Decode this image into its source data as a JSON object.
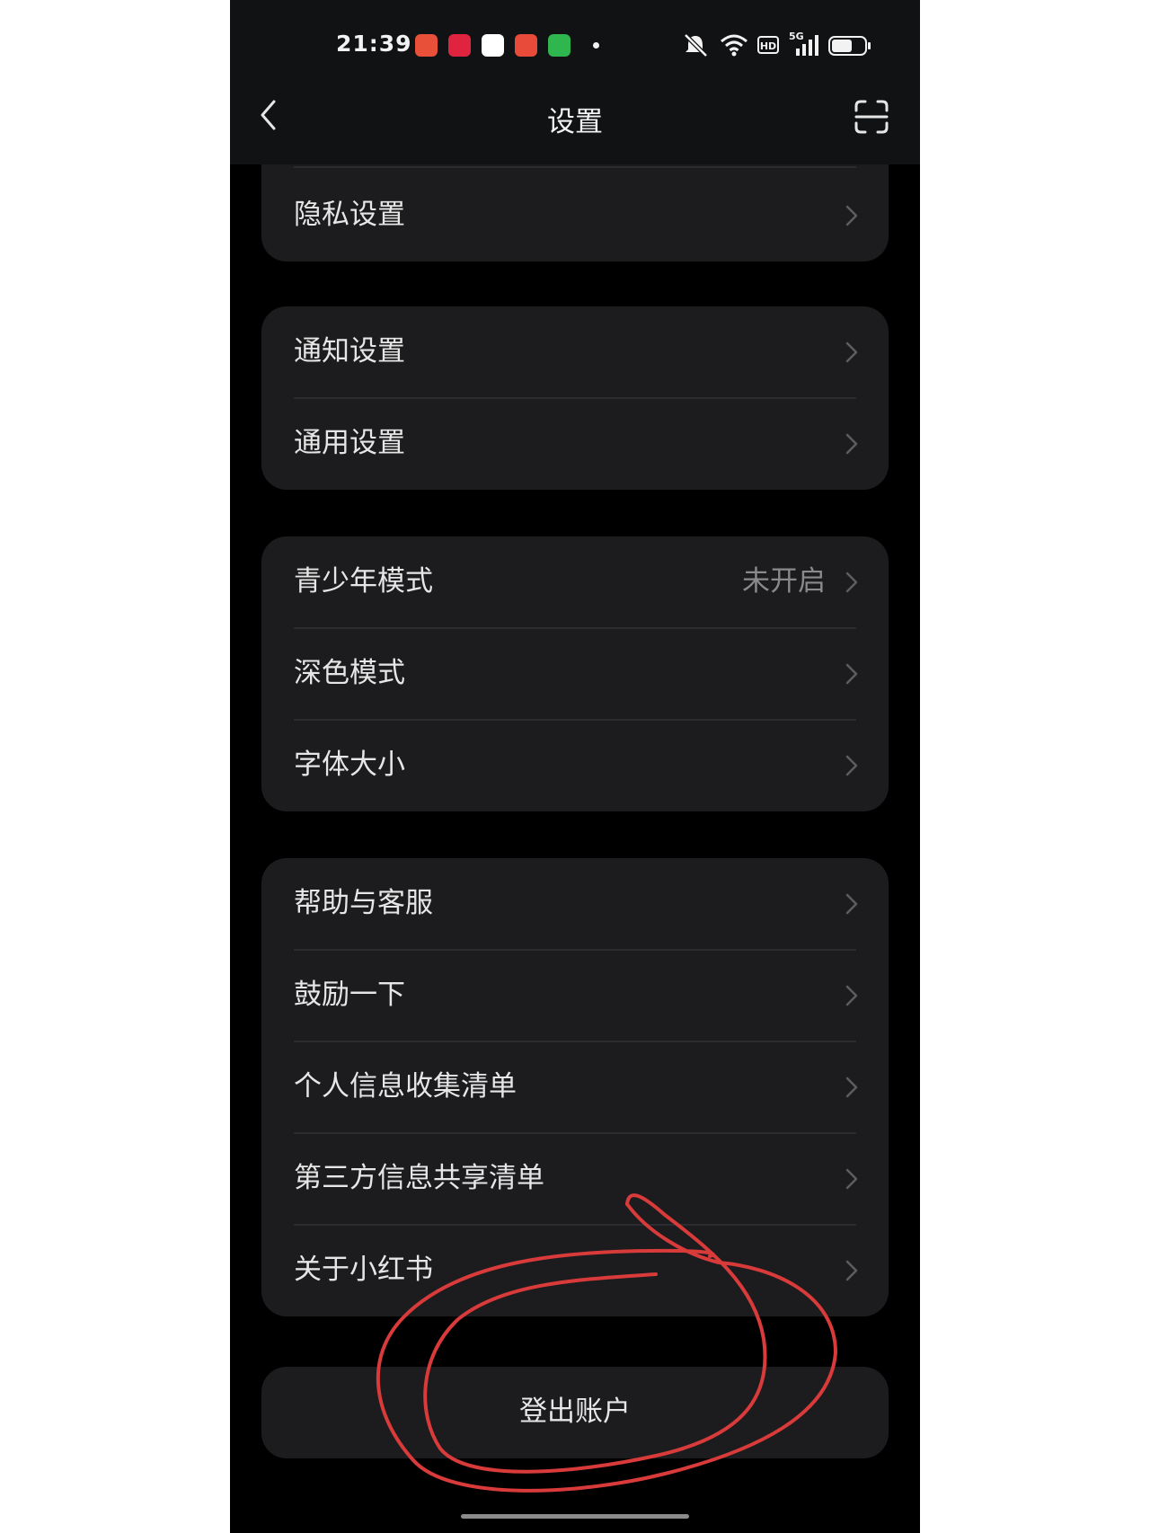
{
  "status_bar": {
    "time": "21:39",
    "network": "5G"
  },
  "nav": {
    "title": "设置"
  },
  "groups": [
    {
      "items": [
        {
          "label": "隐私设置"
        }
      ]
    },
    {
      "items": [
        {
          "label": "通知设置"
        },
        {
          "label": "通用设置"
        }
      ]
    },
    {
      "items": [
        {
          "label": "青少年模式",
          "value": "未开启"
        },
        {
          "label": "深色模式"
        },
        {
          "label": "字体大小"
        }
      ]
    },
    {
      "items": [
        {
          "label": "帮助与客服"
        },
        {
          "label": "鼓励一下"
        },
        {
          "label": "个人信息收集清单"
        },
        {
          "label": "第三方信息共享清单"
        },
        {
          "label": "关于小红书"
        }
      ]
    }
  ],
  "logout": {
    "label": "登出账户"
  },
  "colors": {
    "background": "#000000",
    "card": "#1c1c1f",
    "text": "#e6e6e6",
    "muted": "#8a8a8d",
    "annotation": "#d93a3a"
  },
  "icons": [
    "back-arrow-icon",
    "scan-icon",
    "chevron-right-icon",
    "mute-icon",
    "wifi-icon",
    "hd-icon",
    "signal-icon",
    "battery-icon"
  ]
}
